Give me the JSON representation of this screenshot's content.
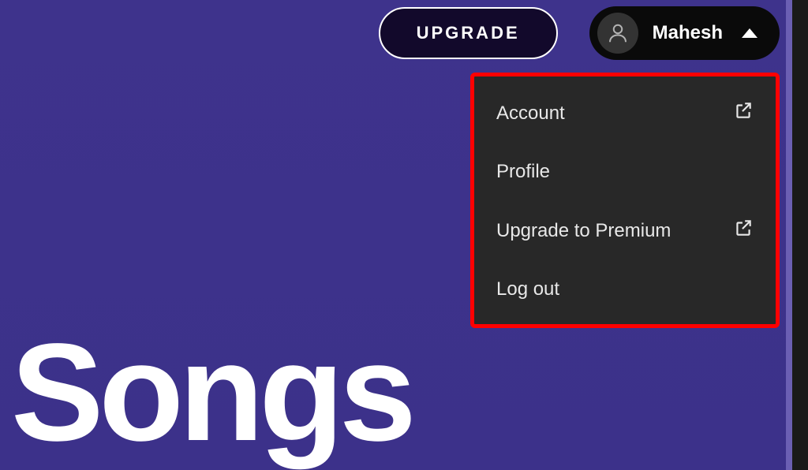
{
  "header": {
    "upgrade_label": "UPGRADE",
    "user_name": "Mahesh"
  },
  "menu": {
    "items": [
      {
        "label": "Account",
        "external": true
      },
      {
        "label": "Profile",
        "external": false
      },
      {
        "label": "Upgrade to Premium",
        "external": true
      },
      {
        "label": "Log out",
        "external": false
      }
    ]
  },
  "page": {
    "title": "Songs"
  }
}
